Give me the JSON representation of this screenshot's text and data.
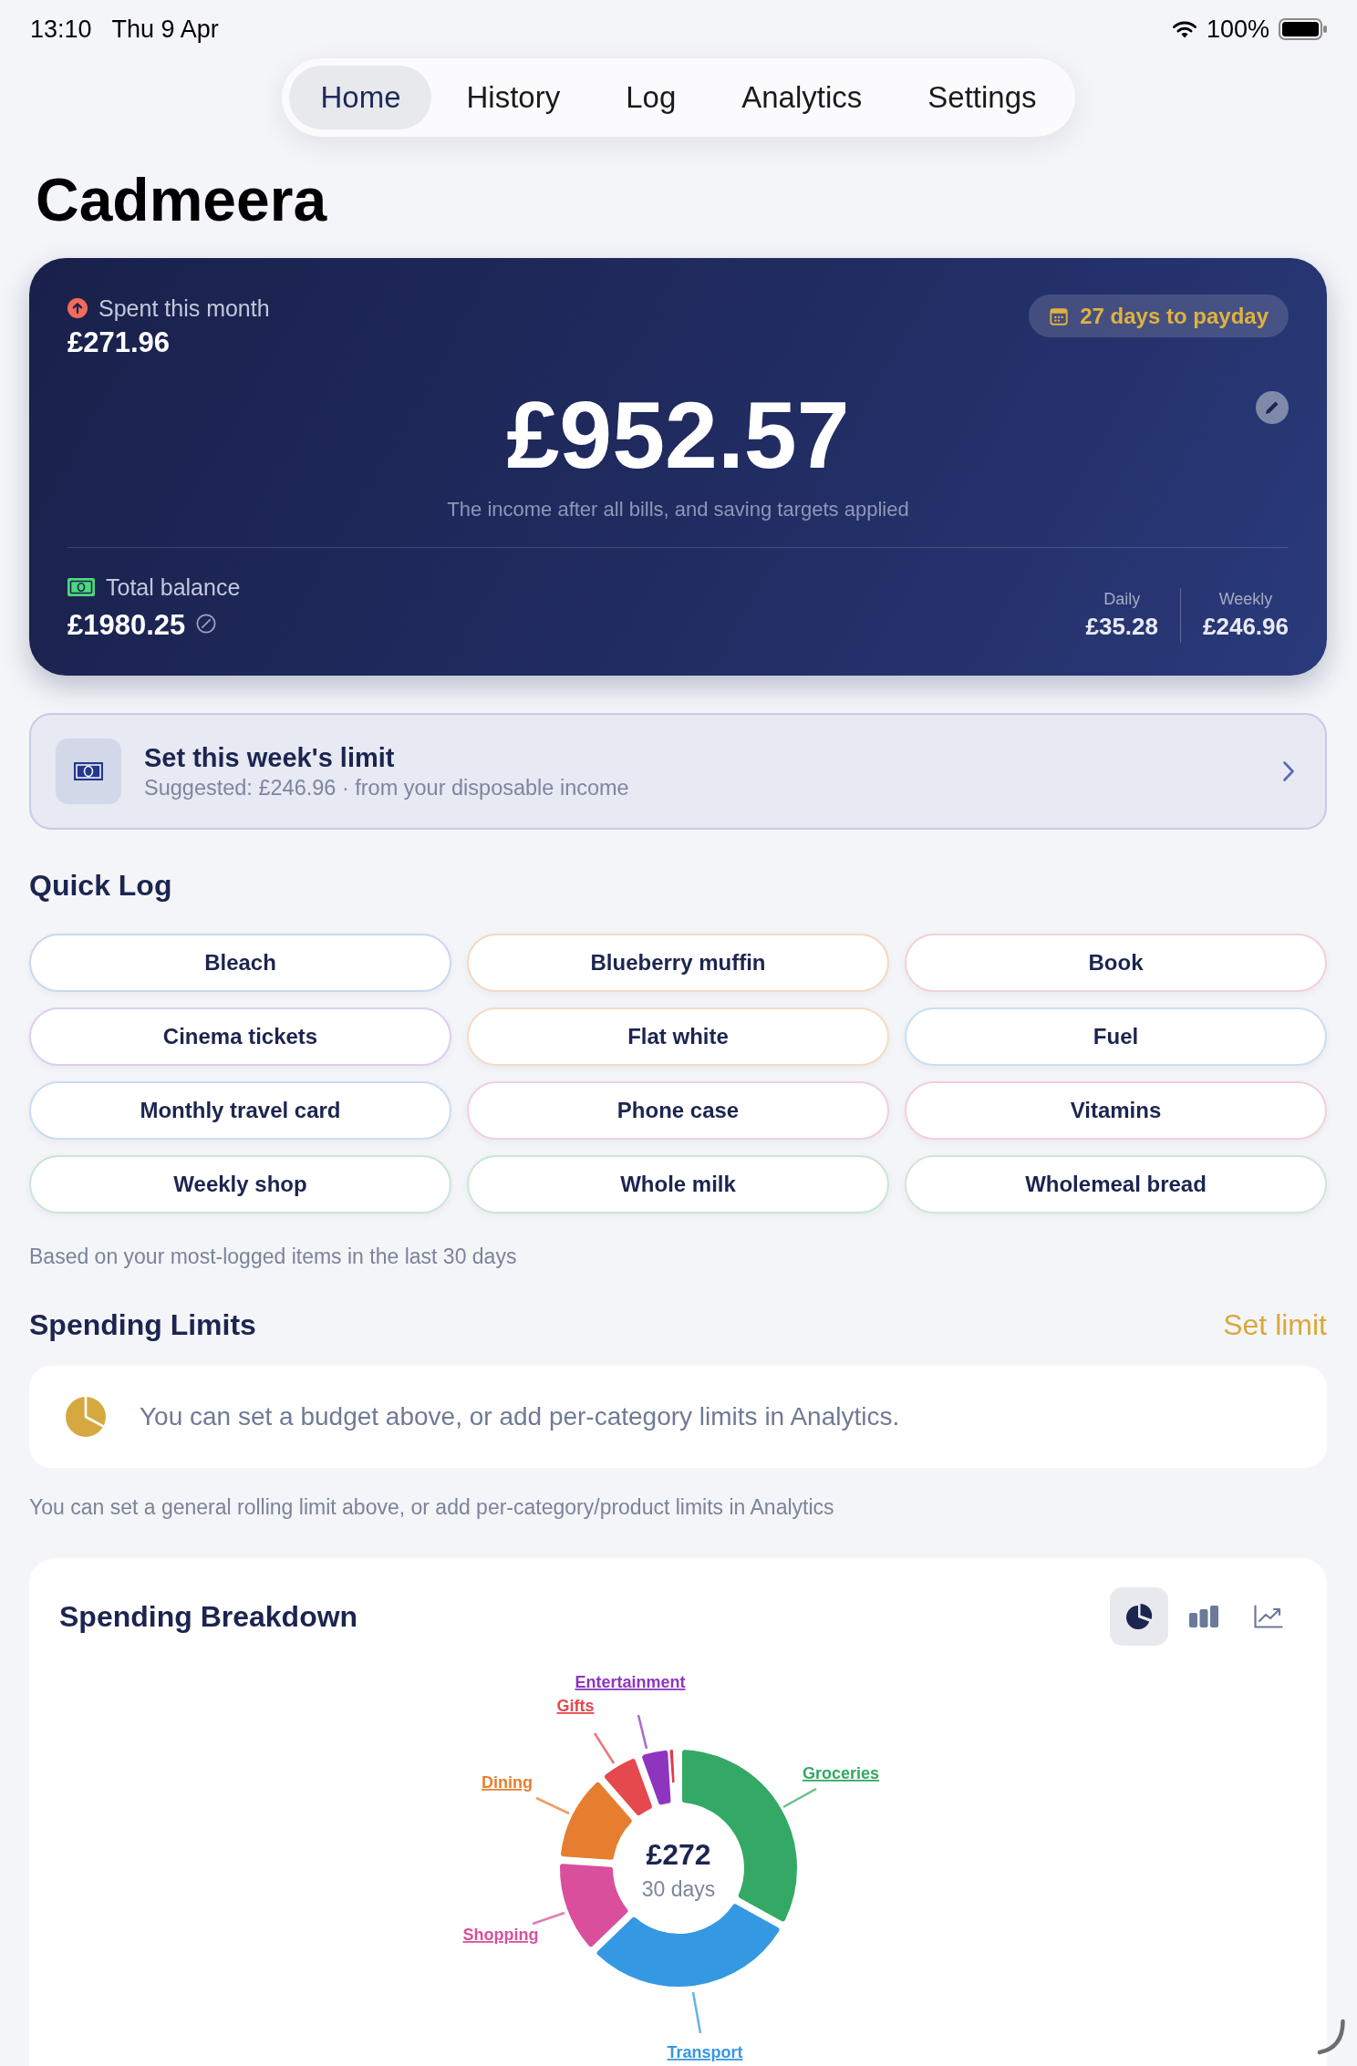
{
  "status_bar": {
    "time": "13:10",
    "date": "Thu 9 Apr",
    "battery": "100%"
  },
  "tabs": [
    {
      "label": "Home",
      "selected": true
    },
    {
      "label": "History",
      "selected": false
    },
    {
      "label": "Log",
      "selected": false
    },
    {
      "label": "Analytics",
      "selected": false
    },
    {
      "label": "Settings",
      "selected": false
    }
  ],
  "title": "Cadmeera",
  "summary": {
    "spent_label": "Spent this month",
    "spent_value": "£271.96",
    "payday": "27 days to payday",
    "amount": "£952.57",
    "caption": "The income after all bills, and saving targets applied",
    "balance_label": "Total balance",
    "balance_value": "£1980.25",
    "rates": [
      {
        "label": "Daily",
        "value": "£35.28"
      },
      {
        "label": "Weekly",
        "value": "£246.96"
      }
    ]
  },
  "week_limit": {
    "title": "Set this week's limit",
    "subtitle": "Suggested: £246.96 · from your disposable income"
  },
  "quick_log": {
    "heading": "Quick Log",
    "items": [
      {
        "label": "Bleach",
        "color": "#c9d8f0"
      },
      {
        "label": "Blueberry muffin",
        "color": "#f3d9c2"
      },
      {
        "label": "Book",
        "color": "#f3d0d8"
      },
      {
        "label": "Cinema tickets",
        "color": "#dfcdef"
      },
      {
        "label": "Flat white",
        "color": "#f3dcc2"
      },
      {
        "label": "Fuel",
        "color": "#c9dff2"
      },
      {
        "label": "Monthly travel card",
        "color": "#c9dcf2"
      },
      {
        "label": "Phone case",
        "color": "#eed0e2"
      },
      {
        "label": "Vitamins",
        "color": "#f1cfd6"
      },
      {
        "label": "Weekly shop",
        "color": "#c8e6d4"
      },
      {
        "label": "Whole milk",
        "color": "#c8e6d4"
      },
      {
        "label": "Wholemeal bread",
        "color": "#cfe6d7"
      }
    ],
    "note": "Based on your most-logged items in the last 30 days"
  },
  "spending_limits": {
    "heading": "Spending Limits",
    "action": "Set limit",
    "message": "You can set a budget above, or add per-category limits in Analytics.",
    "note": "You can set a general rolling limit above, or add per-category/product limits in Analytics"
  },
  "breakdown": {
    "title": "Spending Breakdown",
    "views": [
      {
        "kind": "pie",
        "selected": true
      },
      {
        "kind": "bar",
        "selected": false
      },
      {
        "kind": "line",
        "selected": false
      }
    ],
    "total": "£272",
    "period": "30 days",
    "slices": [
      {
        "label": "Groceries",
        "color": "#34a865"
      },
      {
        "label": "Transport",
        "color": "#3598e2"
      },
      {
        "label": "Shopping",
        "color": "#d94f9c"
      },
      {
        "label": "Dining",
        "color": "#e67e30"
      },
      {
        "label": "Gifts",
        "color": "#e5484d"
      },
      {
        "label": "Entertainment",
        "color": "#8e35c0"
      },
      {
        "color": "#e5394a"
      }
    ]
  }
}
